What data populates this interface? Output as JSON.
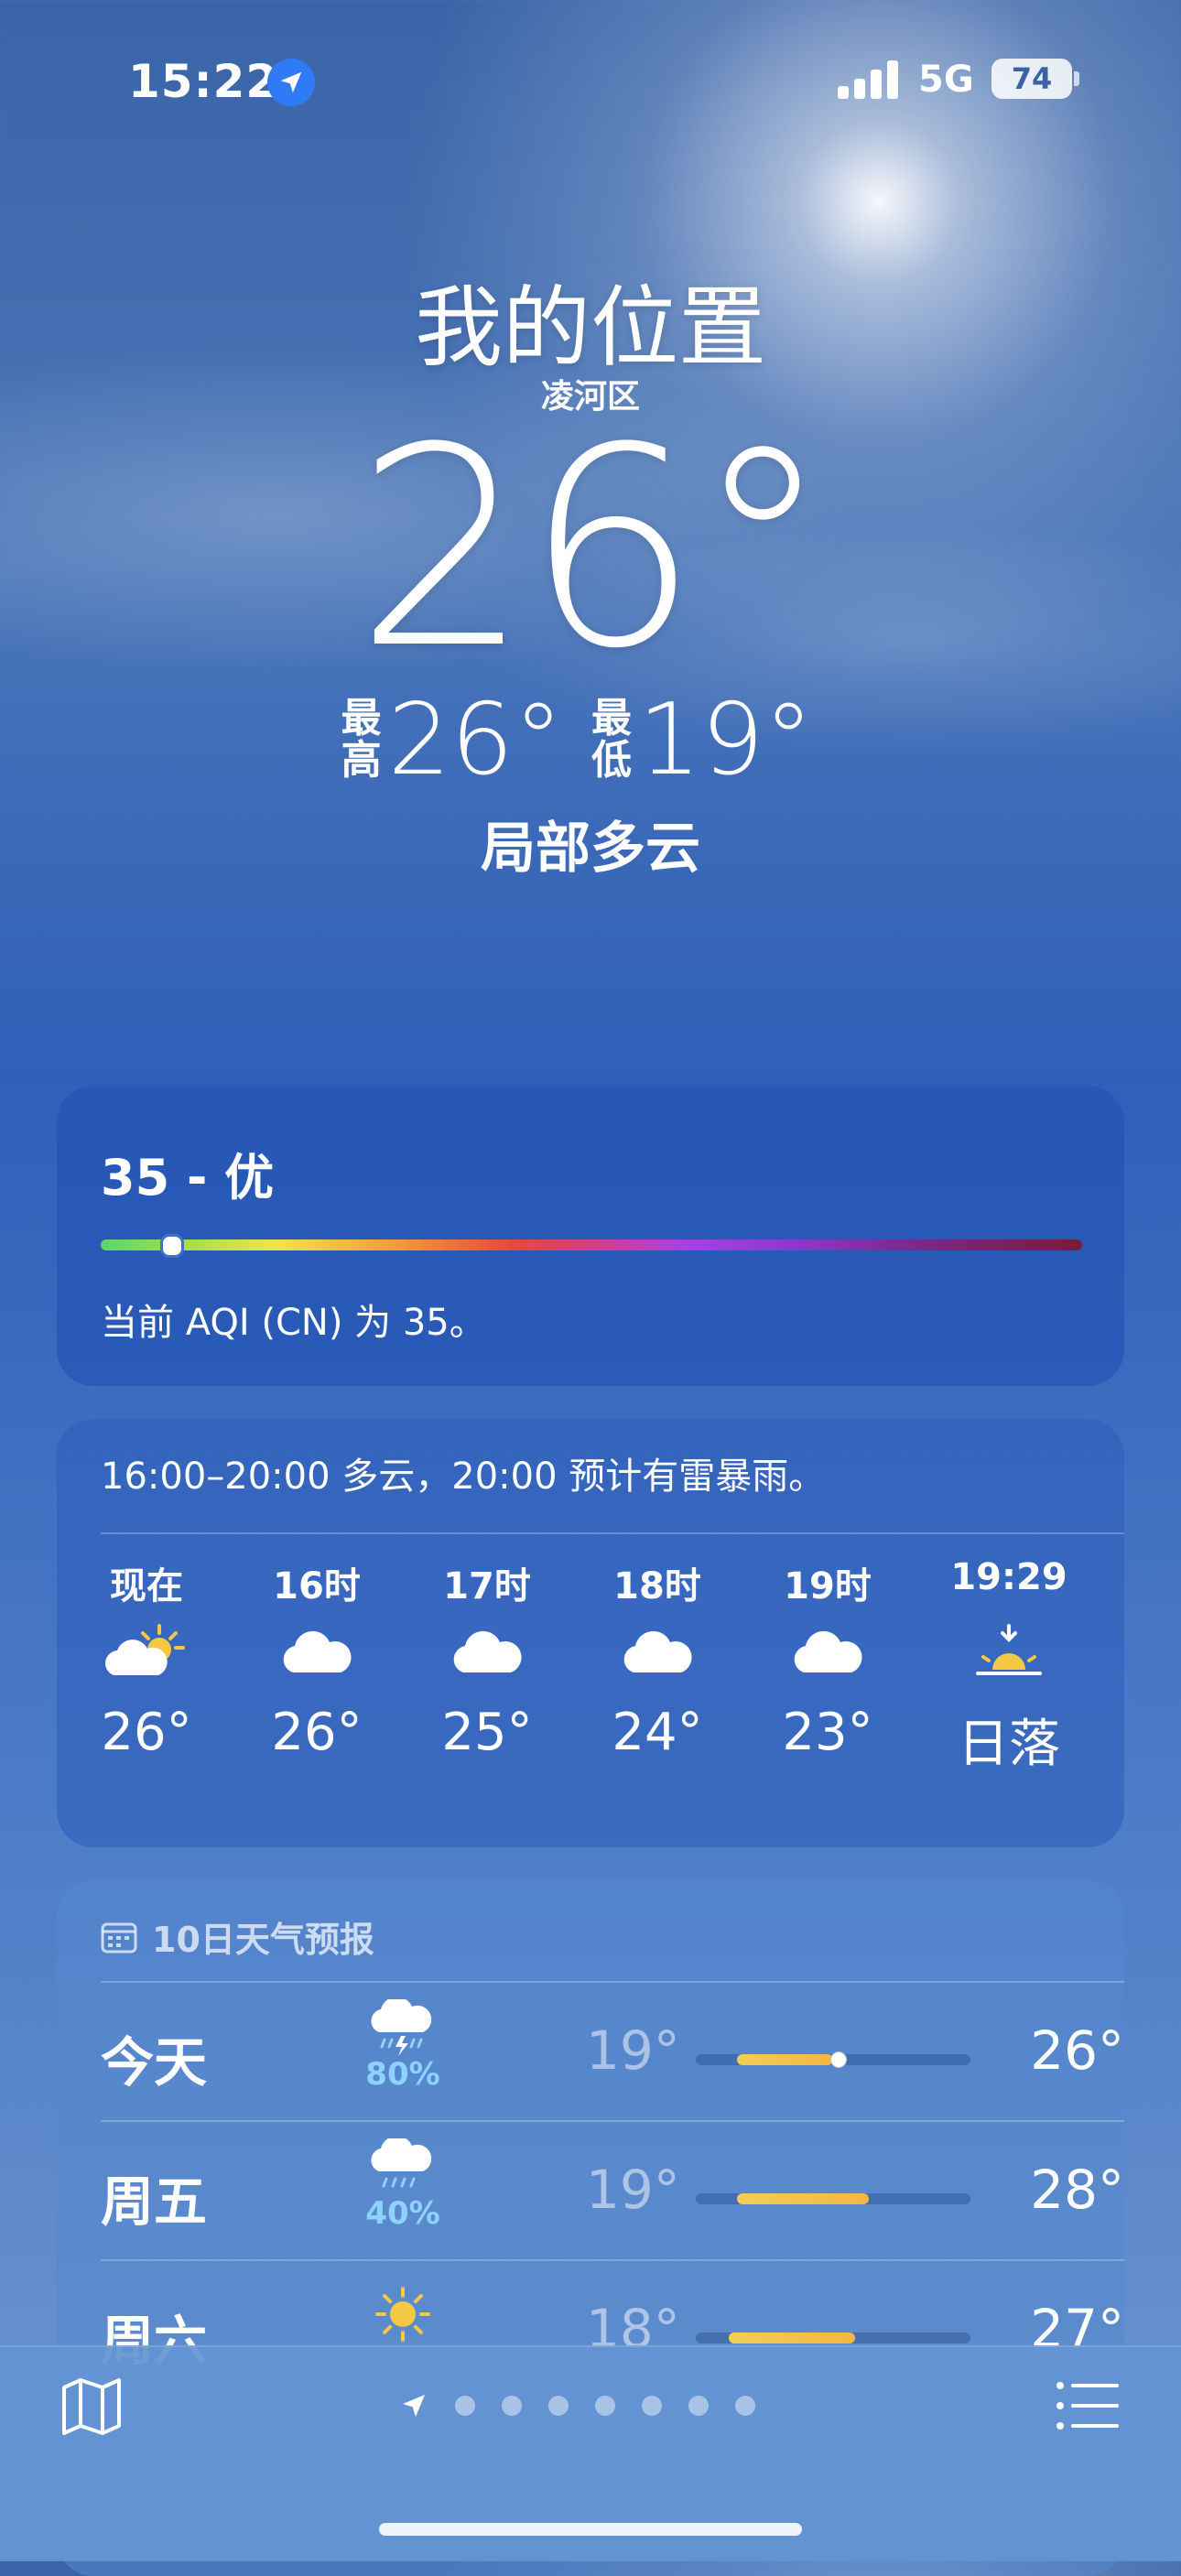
{
  "status_bar": {
    "time": "15:22",
    "network": "5G",
    "battery": "74"
  },
  "location": {
    "title": "我的位置",
    "district": "凌河区"
  },
  "current": {
    "temperature": "26°",
    "high_label": "最高",
    "high": "26°",
    "low_label": "最低",
    "low": "19°",
    "condition": "局部多云"
  },
  "aqi": {
    "title": "35 - 优",
    "value_fraction": 0.07,
    "description": "当前 AQI (CN) 为 35。"
  },
  "hourly": {
    "summary": "16:00–20:00 多云，20:00 预计有雷暴雨。",
    "items": [
      {
        "label": "现在",
        "icon": "partly-sunny-icon",
        "value": "26°"
      },
      {
        "label": "16时",
        "icon": "cloud-icon",
        "value": "26°"
      },
      {
        "label": "17时",
        "icon": "cloud-icon",
        "value": "25°"
      },
      {
        "label": "18时",
        "icon": "cloud-icon",
        "value": "24°"
      },
      {
        "label": "19时",
        "icon": "cloud-icon",
        "value": "23°"
      },
      {
        "label": "19:29",
        "icon": "sunset-icon",
        "value": "日落"
      }
    ]
  },
  "forecast": {
    "header": "10日天气预报",
    "days": [
      {
        "day": "今天",
        "icon": "thunderstorm-rain-icon",
        "pop": "80%",
        "low": "19°",
        "high": "26°",
        "range_start": 0.15,
        "range_end": 0.5,
        "current": 0.52
      },
      {
        "day": "周五",
        "icon": "rain-icon",
        "pop": "40%",
        "low": "19°",
        "high": "28°",
        "range_start": 0.15,
        "range_end": 0.63
      },
      {
        "day": "周六",
        "icon": "sun-icon",
        "pop": "",
        "low": "18°",
        "high": "27°",
        "range_start": 0.12,
        "range_end": 0.58
      }
    ]
  },
  "colors": {
    "accent": "#2f7bf6",
    "pop": "#8dd2ff",
    "temp_bar": "#f2cf55"
  },
  "bottom_bar": {
    "map_icon": "map-icon",
    "list_icon": "list-icon",
    "page_count": 7,
    "location_icon": "location-arrow-icon"
  }
}
